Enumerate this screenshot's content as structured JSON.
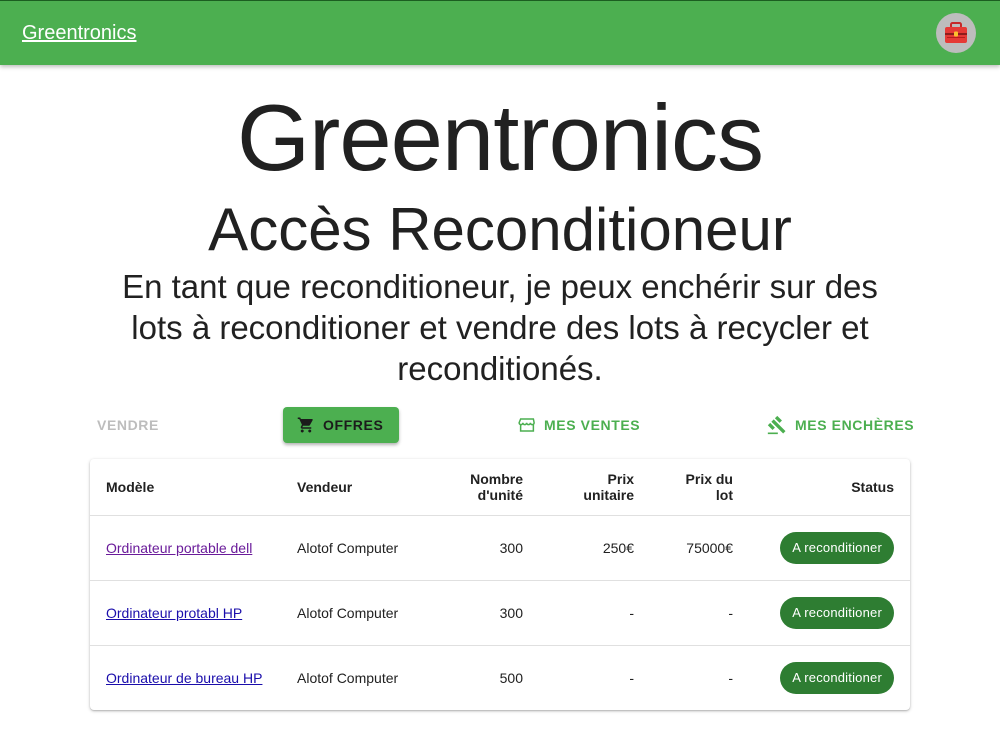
{
  "appbar": {
    "brand": "Greentronics",
    "avatar_icon": "toolbox-icon"
  },
  "hero": {
    "title": "Greentronics",
    "subtitle": "Accès Reconditioneur",
    "description": "En tant que reconditioneur, je peux enchérir sur des lots à reconditioner et vendre des lots à recycler et reconditionés."
  },
  "nav": {
    "sell": {
      "label": "Vendre"
    },
    "offers": {
      "label": "Offres",
      "icon": "cart-icon"
    },
    "my_sales": {
      "label": "Mes ventes",
      "icon": "storefront-icon"
    },
    "my_bids": {
      "label": "Mes enchères",
      "icon": "gavel-icon"
    }
  },
  "table": {
    "headers": {
      "model": "Modèle",
      "seller": "Vendeur",
      "units": "Nombre d'unité",
      "unit_price": "Prix unitaire",
      "lot_price": "Prix du lot",
      "status": "Status"
    },
    "rows": [
      {
        "model": "Ordinateur portable dell",
        "seller": "Alotof Computer",
        "units": "300",
        "unit_price": "250€",
        "lot_price": "75000€",
        "status": "A reconditioner"
      },
      {
        "model": "Ordinateur protabl HP",
        "seller": "Alotof Computer",
        "units": "300",
        "unit_price": "-",
        "lot_price": "-",
        "status": "A reconditioner"
      },
      {
        "model": "Ordinateur de bureau HP",
        "seller": "Alotof Computer",
        "units": "500",
        "unit_price": "-",
        "lot_price": "-",
        "status": "A reconditioner"
      }
    ]
  },
  "colors": {
    "primary": "#4caf50",
    "chip": "#2e7d32",
    "link": "#1a0dab",
    "visited_link": "#6a1b9a"
  }
}
